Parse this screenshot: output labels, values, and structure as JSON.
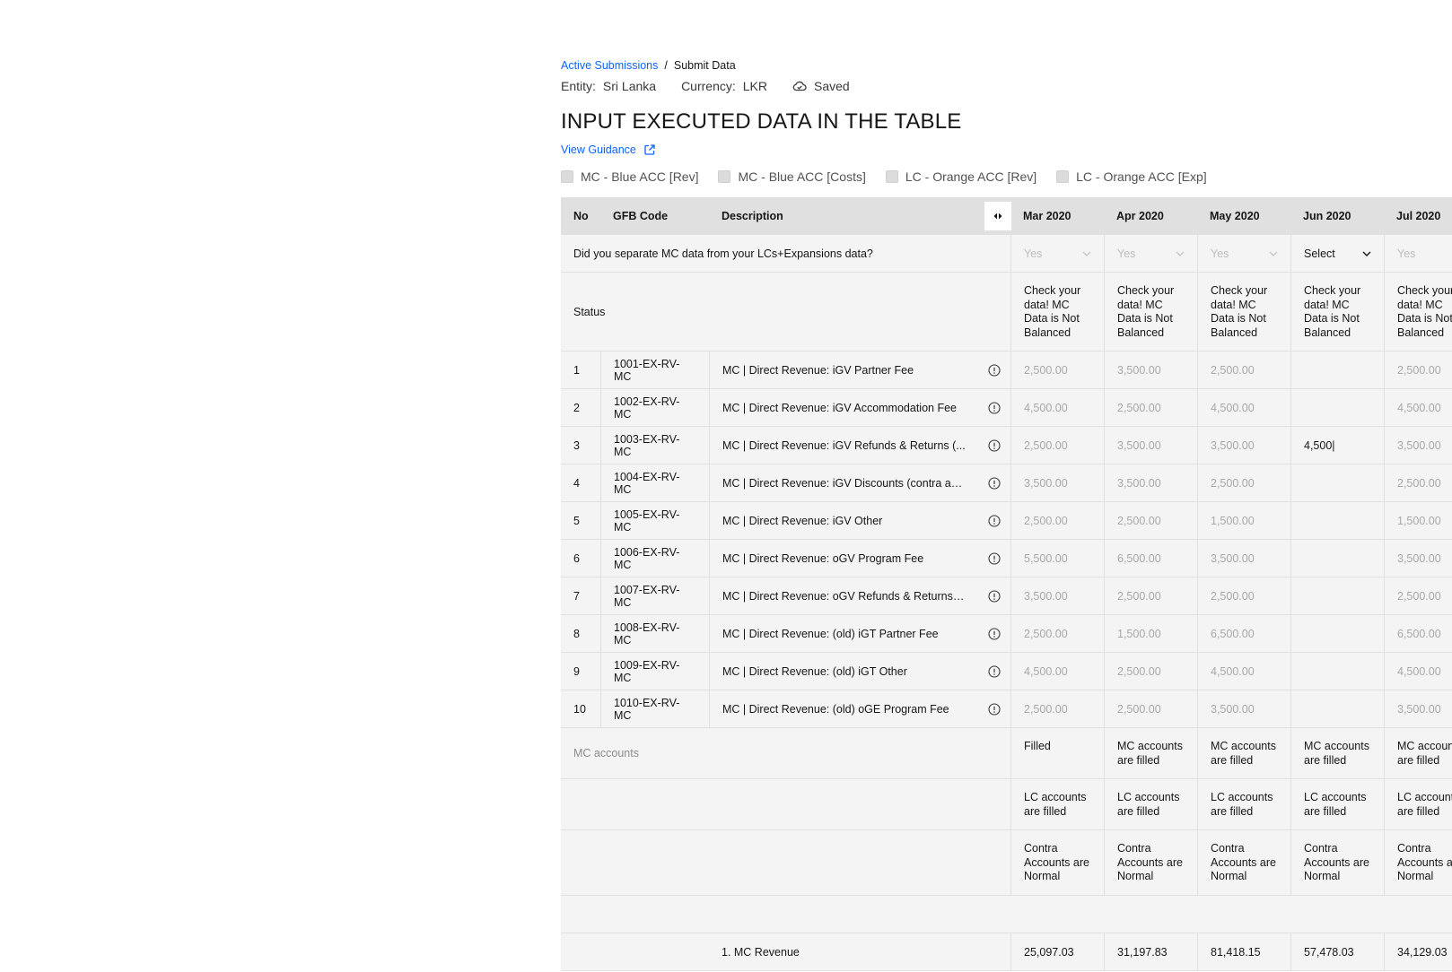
{
  "breadcrumb": {
    "link": "Active Submissions",
    "separator": "/",
    "current": "Submit Data"
  },
  "meta": {
    "entity_label": "Entity:",
    "entity": "Sri Lanka",
    "currency_label": "Currency:",
    "currency": "LKR",
    "saved": "Saved"
  },
  "page_title": "INPUT EXECUTED DATA IN THE TABLE",
  "guidance_link": "View Guidance",
  "filters": [
    "MC - Blue ACC [Rev]",
    "MC - Blue ACC [Costs]",
    "LC - Orange ACC [Rev]",
    "LC - Orange ACC [Exp]"
  ],
  "table": {
    "headers": {
      "no": "No",
      "code": "GFB Code",
      "desc": "Description"
    },
    "months": [
      "Mar 2020",
      "Apr 2020",
      "May 2020",
      "Jun 2020",
      "Jul 2020"
    ],
    "question": {
      "label": "Did you separate MC data from your LCs+Expansions data?",
      "values": [
        "Yes",
        "Yes",
        "Yes",
        "Select",
        "Yes"
      ]
    },
    "status": {
      "label": "Status",
      "values": [
        "Check your data! MC Data is Not Balanced",
        "Check your data! MC Data is Not Balanced",
        "Check your data! MC Data is Not Balanced",
        "Check your data! MC Data is Not Balanced",
        "Check your data! MC Data is Not Balanced"
      ]
    },
    "rows": [
      {
        "no": "1",
        "code": "1001-EX-RV-MC",
        "desc": "MC | Direct Revenue: iGV Partner Fee",
        "values": [
          "2,500.00",
          "3,500.00",
          "2,500.00",
          "",
          "2,500.00"
        ]
      },
      {
        "no": "2",
        "code": "1002-EX-RV-MC",
        "desc": "MC | Direct Revenue: iGV Accommodation Fee",
        "values": [
          "4,500.00",
          "2,500.00",
          "4,500.00",
          "",
          "4,500.00"
        ]
      },
      {
        "no": "3",
        "code": "1003-EX-RV-MC",
        "desc": "MC | Direct Revenue: iGV Refunds & Returns (...",
        "values": [
          "2,500.00",
          "3,500.00",
          "3,500.00",
          "4,500|",
          "3,500.00"
        ]
      },
      {
        "no": "4",
        "code": "1004-EX-RV-MC",
        "desc": "MC | Direct Revenue: iGV Discounts (contra ac...",
        "values": [
          "3,500.00",
          "3,500.00",
          "2,500.00",
          "",
          "2,500.00"
        ]
      },
      {
        "no": "5",
        "code": "1005-EX-RV-MC",
        "desc": "MC | Direct Revenue: iGV Other",
        "values": [
          "2,500.00",
          "2,500.00",
          "1,500.00",
          "",
          "1,500.00"
        ]
      },
      {
        "no": "6",
        "code": "1006-EX-RV-MC",
        "desc": "MC | Direct Revenue: oGV Program Fee",
        "values": [
          "5,500.00",
          "6,500.00",
          "3,500.00",
          "",
          "3,500.00"
        ]
      },
      {
        "no": "7",
        "code": "1007-EX-RV-MC",
        "desc": "MC | Direct Revenue: oGV Refunds & Returns (...",
        "values": [
          "3,500.00",
          "2,500.00",
          "2,500.00",
          "",
          "2,500.00"
        ]
      },
      {
        "no": "8",
        "code": "1008-EX-RV-MC",
        "desc": "MC | Direct Revenue: (old) iGT Partner Fee",
        "values": [
          "2,500.00",
          "1,500.00",
          "6,500.00",
          "",
          "6,500.00"
        ]
      },
      {
        "no": "9",
        "code": "1009-EX-RV-MC",
        "desc": "MC | Direct Revenue: (old) iGT Other",
        "values": [
          "4,500.00",
          "2,500.00",
          "4,500.00",
          "",
          "4,500.00"
        ]
      },
      {
        "no": "10",
        "code": "1010-EX-RV-MC",
        "desc": "MC | Direct Revenue: (old) oGE Program Fee",
        "values": [
          "2,500.00",
          "2,500.00",
          "3,500.00",
          "",
          "3,500.00"
        ]
      }
    ],
    "checks": [
      {
        "label": "MC accounts",
        "values": [
          "Filled",
          "MC accounts are filled",
          "MC accounts are filled",
          "MC accounts are filled",
          "MC accounts are filled"
        ]
      },
      {
        "label": "",
        "values": [
          "LC accounts are filled",
          "LC accounts are filled",
          "LC accounts are filled",
          "LC accounts are filled",
          "LC accounts are filled"
        ]
      },
      {
        "label": "",
        "values": [
          "Contra Accounts are Normal",
          "Contra Accounts are Normal",
          "Contra Accounts are Normal",
          "Contra Accounts are Normal",
          "Contra Accounts are Normal"
        ]
      }
    ],
    "totals": {
      "label": "1. MC Revenue",
      "values": [
        "25,097.03",
        "31,197.83",
        "81,418.15",
        "57,478.03",
        "34,129.03"
      ]
    }
  }
}
